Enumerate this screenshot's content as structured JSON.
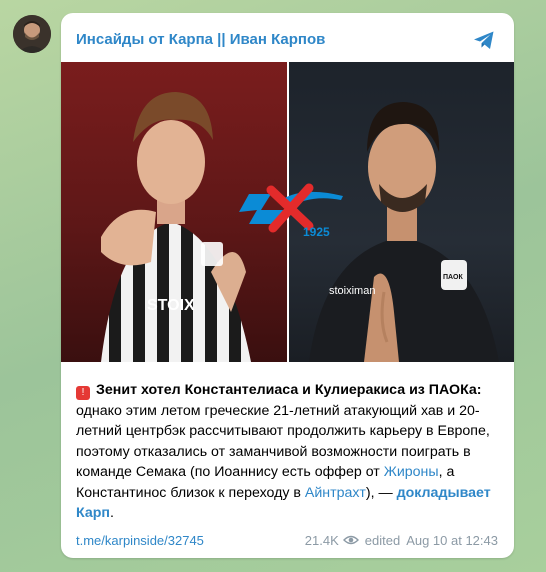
{
  "channel": {
    "title": "Инсайды от Карпа || Иван Карпов"
  },
  "media": {
    "left_shirt_text": "STOIX",
    "right_sponsor_text": "stoiximan",
    "right_crest_text": "ПАОК",
    "logo_year": "1925"
  },
  "post": {
    "bold_text": "Зенит хотел Константелиаса и Кулиеракиса из ПАОКа:",
    "text_part1": " однако этим летом греческие 21-летний атакующий хав и 20-летний центрбэк рассчитывают продолжить карьеру в Европе, поэтому отказались от заманчивой возможности поиграть в команде Семака (по Иоаннису есть оффер от ",
    "link_girona": "Жироны",
    "text_part2": ", а Константинос близок к переходу в ",
    "link_eintracht": "Айнтрахт",
    "text_part3": "), — ",
    "link_source": "докладывает Карп",
    "text_end": "."
  },
  "footer": {
    "post_link": "t.me/karpinside/32745",
    "views": "21.4K",
    "edited_label": "edited",
    "date": "Aug 10 at 12:43"
  },
  "colors": {
    "accent": "#2f87c8",
    "meta": "#8c9aa5",
    "flag": "#e53935"
  },
  "icons": {
    "share": "telegram-share-icon",
    "views": "eye-icon",
    "flag": "siren-icon"
  }
}
